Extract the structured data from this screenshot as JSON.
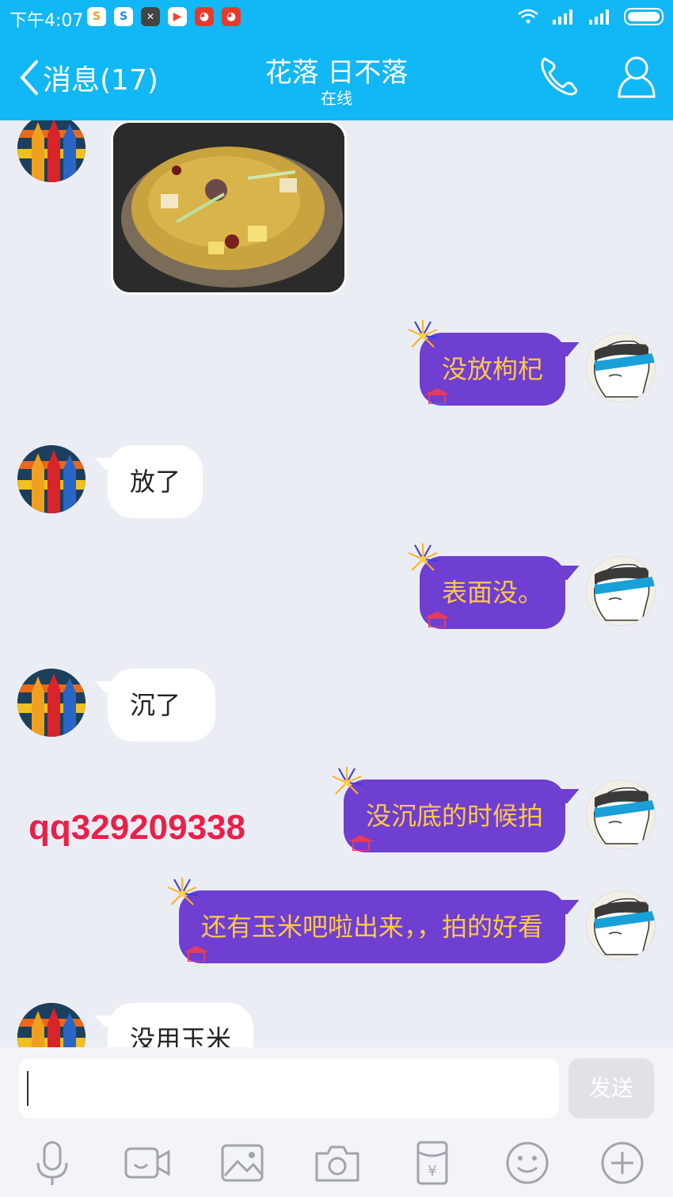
{
  "status": {
    "time": "下午4:07"
  },
  "header": {
    "back_label": "消息(17)",
    "title": "花落  日不落",
    "subtitle": "在线"
  },
  "messages": [
    {
      "side": "in",
      "type": "image"
    },
    {
      "side": "out",
      "text": "没放枸杞"
    },
    {
      "side": "in",
      "text": "放了"
    },
    {
      "side": "out",
      "text": "表面没。"
    },
    {
      "side": "in",
      "text": "沉了"
    },
    {
      "side": "out",
      "text": "没沉底的时候拍"
    },
    {
      "side": "out",
      "text": "还有玉米吧啦出来，，拍的好看"
    },
    {
      "side": "in",
      "text": "没用玉米"
    }
  ],
  "watermark": "qq329209338",
  "input": {
    "send_label": "发送"
  },
  "toolbar_icons": [
    "mic-icon",
    "video-icon",
    "image-icon",
    "camera-icon",
    "red-packet-icon",
    "emoji-icon",
    "plus-icon"
  ],
  "colors": {
    "header": "#12b7f5",
    "out_bubble": "#6e3fd0",
    "out_text": "#ffc74a",
    "watermark": "#e8204a"
  }
}
